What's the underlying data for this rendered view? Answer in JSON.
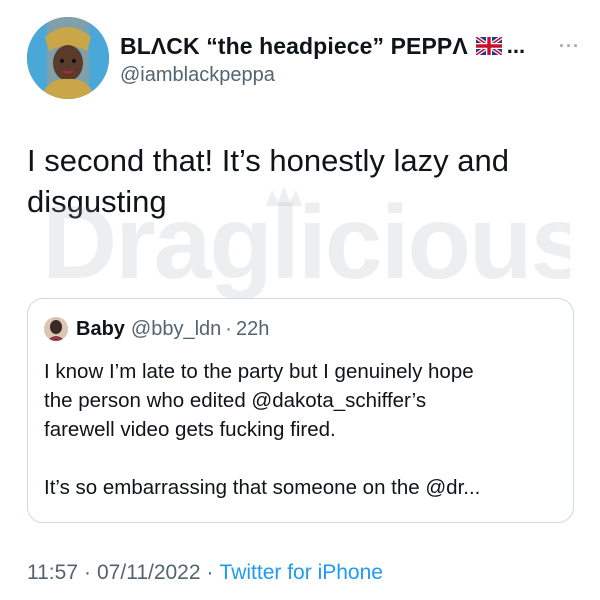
{
  "author": {
    "display_name": "BLΛCK “the headpiece” PEPPΛ",
    "name_truncation": "...",
    "handle": "@iamblackpeppa",
    "avatar_icon": "avatar-image",
    "flag_icon": "uk-flag-icon"
  },
  "more_icon": "···",
  "tweet": {
    "text_line1": "I second that! It’s honestly lazy and",
    "text_line2": "disgusting"
  },
  "watermark": {
    "text": "Draglicious"
  },
  "quoted_tweet": {
    "name": "Baby",
    "handle": "@bby_ldn",
    "separator": "·",
    "time": "22h",
    "paragraph1_line1": "I know I’m late to the party but I genuinely hope",
    "paragraph1_line2": "the person who edited @dakota_schiffer’s",
    "paragraph1_line3": "farewell video gets fucking fired.",
    "paragraph2": "It’s so embarrassing that someone on the @dr..."
  },
  "footer": {
    "time": "11:57",
    "separator": "·",
    "date": "07/11/2022",
    "source": "Twitter for iPhone"
  },
  "colors": {
    "text": "#0f1419",
    "secondary": "#536471",
    "link": "#1d9bf0",
    "border": "#cfd9de"
  }
}
